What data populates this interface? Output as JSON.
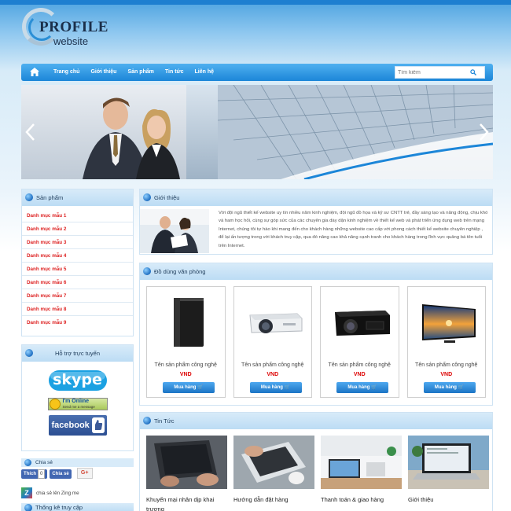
{
  "logo": {
    "line1": "PROFILE",
    "line2": "website"
  },
  "nav": {
    "items": [
      "Trang chủ",
      "Giới thiệu",
      "Sản phẩm",
      "Tin tức",
      "Liên hệ"
    ],
    "search_placeholder": "Tìm kiếm"
  },
  "sidebar": {
    "categories_title": "Sản phẩm",
    "categories": [
      "Danh mục mẫu 1",
      "Danh mục mẫu 2",
      "Danh mục mẫu 3",
      "Danh mục mẫu 4",
      "Danh mục mẫu 5",
      "Danh mục mẫu 6",
      "Danh mục mẫu 7",
      "Danh mục mẫu 8",
      "Danh mục mẫu 9"
    ],
    "support_title": "Hỗ trợ trực tuyến",
    "skype_label": "skype",
    "online_label": "I'm Online",
    "online_sub": "Send me a message",
    "facebook_label": "facebook",
    "share_title": "Chia sẻ",
    "like_label": "Thích",
    "like_count": "0",
    "share_label": "Chia sẻ",
    "gplus_label": "G+",
    "zing_label": "chia sẻ lên Zing me",
    "stats_title": "Thống kê truy cập"
  },
  "intro": {
    "title": "Giới thiệu",
    "text": "Với đội ngũ thiết kế website uy tín nhiều năm kinh nghiệm, đội ngũ đồ họa và kỹ sư CNTT trẻ, đầy sáng tạo và năng động, chịu khó và ham học hỏi, cùng sự góp sức của các chuyên gia dày dặn kinh nghiệm về thiết kế web và phát triển ứng dụng web trên mạng Internet, chúng tôi tự hào khi mang đến cho khách hàng những website cao cấp với phong cách thiết kế website chuyên nghiệp , để lại ấn tượng trong với khách truy cập, qua đó nâng cao khả năng cạnh tranh cho khách hàng trong lĩnh vực quảng bá tên tuổi trên Internet."
  },
  "products": {
    "title": "Đồ dùng văn phòng",
    "items": [
      {
        "name": "Tên sản phẩm công nghệ",
        "price": "VND",
        "buy": "Mua hàng",
        "icon": "speaker-icon"
      },
      {
        "name": "Tên sản phẩm công nghệ",
        "price": "VND",
        "buy": "Mua hàng",
        "icon": "projector-icon"
      },
      {
        "name": "Tên sản phẩm công nghệ",
        "price": "VND",
        "buy": "Mua hàng",
        "icon": "projector-black-icon"
      },
      {
        "name": "Tên sản phẩm công nghệ",
        "price": "VND",
        "buy": "Mua hàng",
        "icon": "tv-icon"
      }
    ]
  },
  "news": {
    "title": "Tin Tức",
    "items": [
      "Khuyến mại nhân dịp khai trương",
      "Hướng dẫn đặt hàng",
      "Thanh toán & giao hàng",
      "Giới thiệu"
    ]
  },
  "colors": {
    "nav": "#1c86d8",
    "price": "#dd0000",
    "category": "#dd2222"
  }
}
